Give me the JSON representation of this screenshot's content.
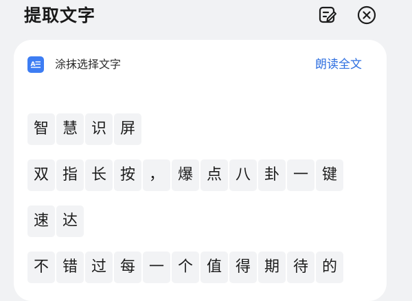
{
  "header": {
    "title": "提取文字",
    "edit_icon": "edit-note-icon",
    "close_icon": "close-circle-icon"
  },
  "card": {
    "smear_icon": "text-document-icon",
    "smear_label": "涂抹选择文字",
    "read_all_label": "朗读全文"
  },
  "colors": {
    "accent": "#2e6fe0",
    "icon_blue": "#3d7df3",
    "char_bg": "#f2f3f5",
    "page_bg": "#f1f2f4"
  },
  "text_lines": [
    [
      "智",
      "慧",
      "识",
      "屏"
    ],
    [
      "双",
      "指",
      "长",
      "按",
      "，",
      "爆",
      "点",
      "八",
      "卦",
      "一",
      "键"
    ],
    [
      "速",
      "达"
    ],
    [
      "不",
      "错",
      "过",
      "每",
      "一",
      "个",
      "值",
      "得",
      "期",
      "待",
      "的"
    ]
  ]
}
